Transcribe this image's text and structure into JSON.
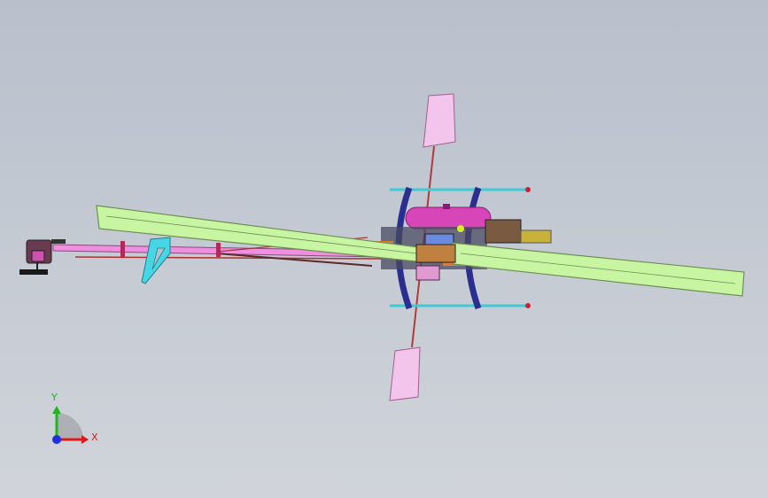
{
  "viewport": {
    "background_top": "#b9c0cc",
    "background_bottom": "#d0d4da"
  },
  "model": {
    "main_blade_color": "#c8f5a2",
    "main_blade_stroke": "#6f8f52",
    "tail_boom_color": "#f08ee0",
    "fin_color": "#47d6e6",
    "fuel_tank_color": "#d845b8",
    "flybar_paddle_color": "#f3c4ec",
    "landing_gear_color": "#2a2f8f",
    "skid_color": "#3fc9d4",
    "motor_color": "#c9b23a"
  },
  "triad": {
    "x_label": "X",
    "y_label": "Y",
    "x_color": "#e01818",
    "y_color": "#22b422",
    "z_color": "#2030e0",
    "x_icon": "arrow-right-icon",
    "y_icon": "arrow-up-icon"
  }
}
